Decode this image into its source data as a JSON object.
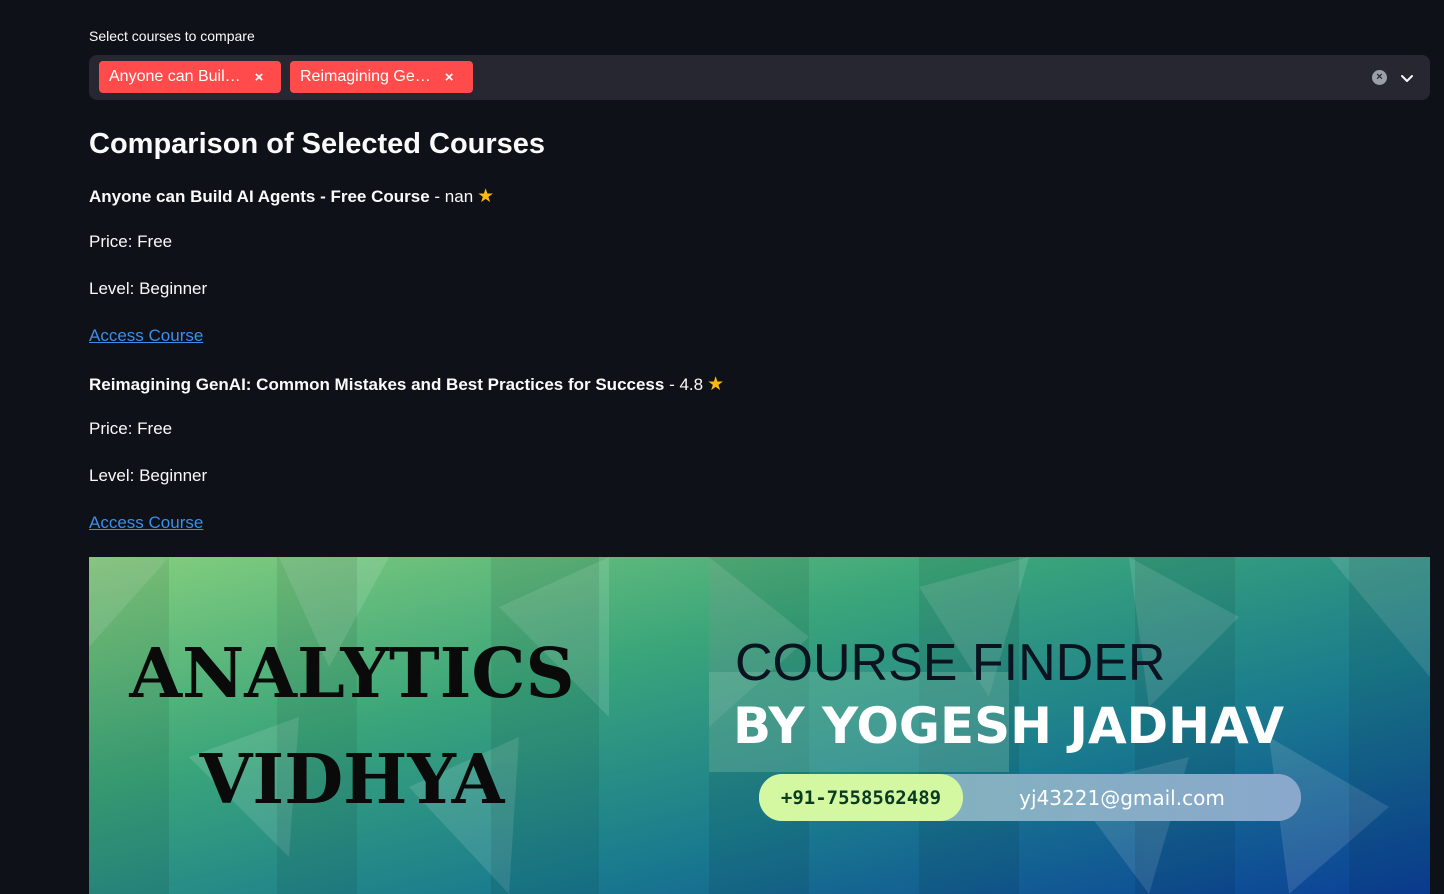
{
  "selector": {
    "label": "Select courses to compare",
    "selected": [
      "Anyone can Buil…",
      "Reimagining Ge…"
    ],
    "remove_glyph": "×"
  },
  "comparison": {
    "title": "Comparison of Selected Courses",
    "courses": [
      {
        "name": "Anyone can Build AI Agents - Free Course",
        "rating": " - nan",
        "price": "Price: Free",
        "level": "Level: Beginner",
        "link_text": "Access Course"
      },
      {
        "name": "Reimagining GenAI: Common Mistakes and Best Practices for Success",
        "rating": " - 4.8",
        "price": "Price: Free",
        "level": "Level: Beginner",
        "link_text": "Access Course"
      }
    ]
  },
  "banner": {
    "brand_line1": "ANALYTICS",
    "brand_line2": "VIDHYA",
    "title_line1": "COURSE FINDER",
    "title_line2": "BY YOGESH JADHAV",
    "phone": "+91-7558562489",
    "email": "yj43221@gmail.com"
  },
  "colors": {
    "background": "#0e1117",
    "tag": "#ff4b4b",
    "link": "#3b8eea",
    "star": "#fdb813"
  }
}
